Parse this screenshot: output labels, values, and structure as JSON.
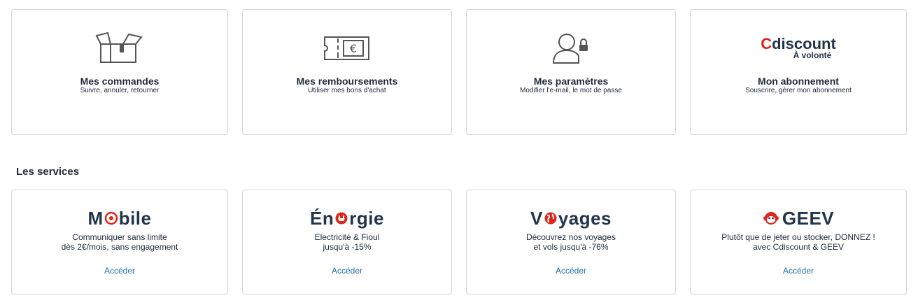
{
  "account_cards": [
    {
      "title": "Mes commandes",
      "subtitle": "Suivre, annuler, retourner",
      "icon": "box-icon"
    },
    {
      "title": "Mes remboursements",
      "subtitle": "Utiliser mes bons d'achat",
      "icon": "euro-voucher-icon"
    },
    {
      "title": "Mes paramètres",
      "subtitle": "Modifier l'e-mail, le mot de passe",
      "icon": "user-lock-icon"
    },
    {
      "title": "Mon abonnement",
      "subtitle": "Souscrire, gérer mon abonnement",
      "logo_main_first": "C",
      "logo_main_rest": "discount",
      "logo_tagline": "À volonté"
    }
  ],
  "services_title": "Les services",
  "services": [
    {
      "logo_a": "M",
      "logo_b": "bile",
      "line1": "Communiquer sans limite",
      "line2": "dès 2€/mois, sans engagement",
      "link": "Accéder"
    },
    {
      "logo_a": "Én",
      "logo_b": "rgie",
      "line1": "Electricité & Fioul",
      "line2": "jusqu'à -15%",
      "link": "Accéder"
    },
    {
      "logo_a": "V",
      "logo_b": "yages",
      "line1": "Découvrez nos voyages",
      "line2": "et vols jusqu'à -76%",
      "link": "Accéder"
    },
    {
      "logo_a": "GEEV",
      "line1": "Plutôt que de jeter ou stocker, DONNEZ !",
      "line2": "avec Cdiscount & GEEV",
      "link": "Accéder"
    }
  ],
  "colors": {
    "brand_red": "#e1251b",
    "navy": "#23344b",
    "link": "#1f6fb3",
    "border": "#d3d6db"
  }
}
